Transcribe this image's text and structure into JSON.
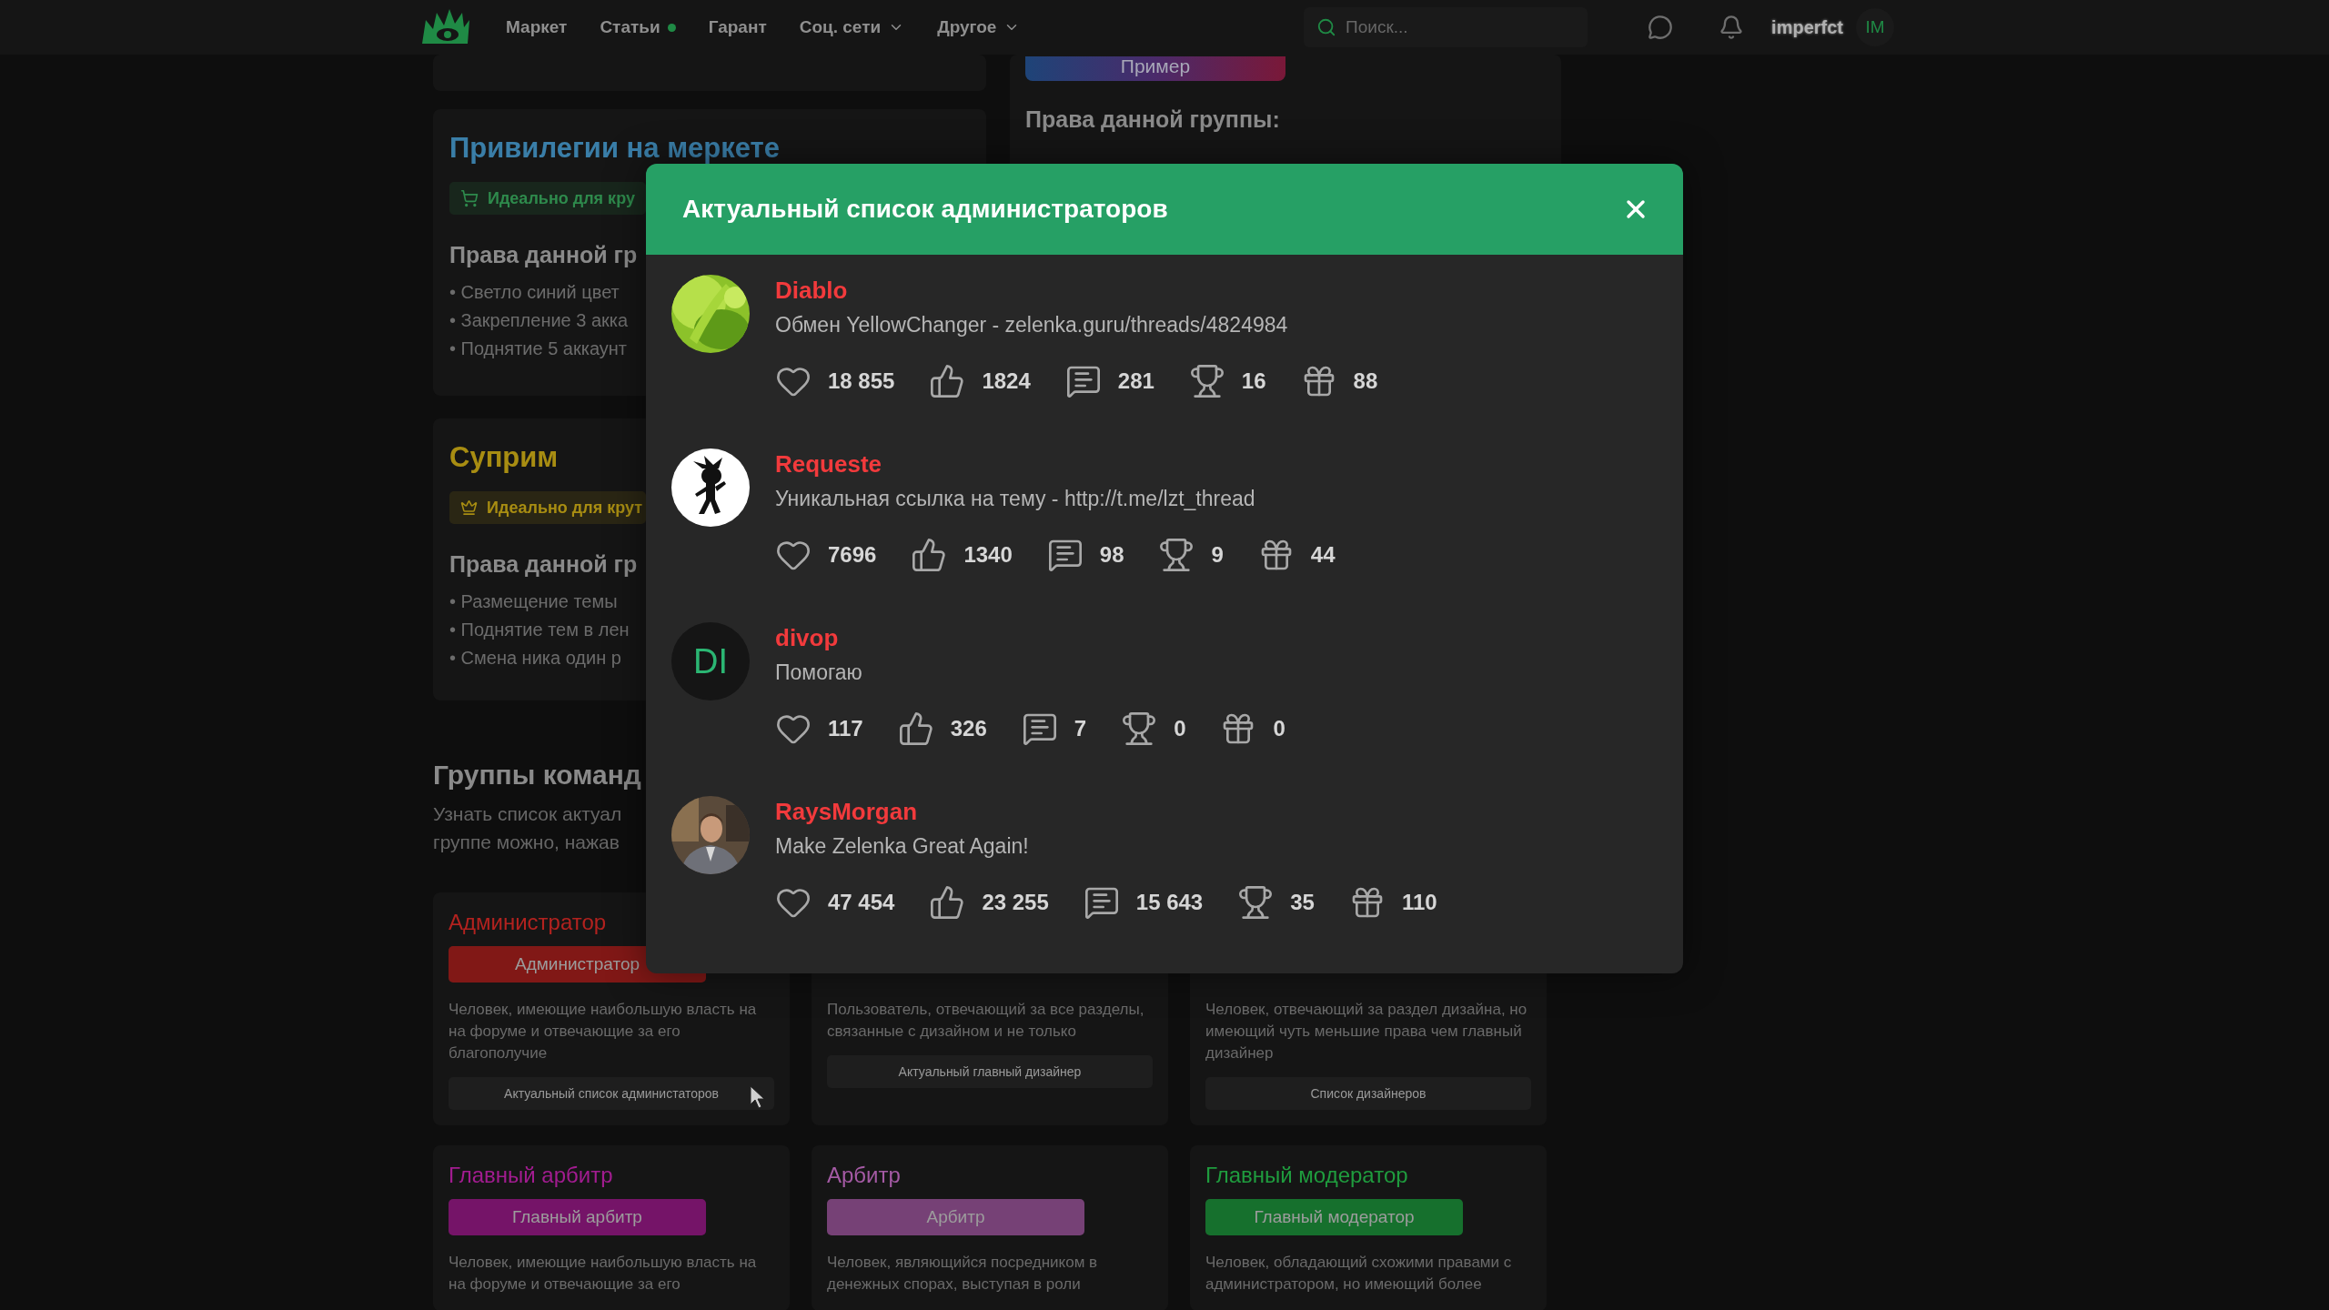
{
  "nav": {
    "items": [
      {
        "label": "Маркет",
        "dot": false,
        "menu": false
      },
      {
        "label": "Статьи",
        "dot": true,
        "menu": false
      },
      {
        "label": "Гарант",
        "dot": false,
        "menu": false
      },
      {
        "label": "Соц. сети",
        "dot": false,
        "menu": true
      },
      {
        "label": "Другое",
        "dot": false,
        "menu": true
      }
    ],
    "search": {
      "placeholder": "Поиск..."
    },
    "user": {
      "name": "imperfct",
      "initials": "IM"
    }
  },
  "privilege_cards": [
    {
      "title": "Привилегии на меркете",
      "color": "#3a7ea8",
      "tag": {
        "text": "Идеально для кру",
        "color": "#2e8a4c"
      },
      "rights_heading": "Права данной гр",
      "rights": [
        "• Светло синий цвет",
        "• Закрепление 3 акка",
        "• Поднятие 5 аккаунт"
      ]
    },
    {
      "title": "Суприм",
      "color": "#a88d12",
      "tag": {
        "text": "Идеально для крут",
        "color": "#a88d12"
      },
      "rights_heading": "Права данной гр",
      "rights": [
        "• Размещение темы",
        "• Поднятие тем в лен",
        "• Смена ника один р"
      ]
    }
  ],
  "example_card": {
    "badge": "Пример",
    "rights_heading": "Права данной группы:"
  },
  "team": {
    "heading": "Группы команд",
    "text_lines": [
      "Узнать список актуал",
      "группе можно, нажав"
    ]
  },
  "groups": [
    {
      "title": "Администратор",
      "color": "#b3221f",
      "badge": "Администратор",
      "description": "Человек, имеющие наибольшую власть на на форуме и отвечающие за его благополучие",
      "button": "Актуальный список администаторов"
    },
    {
      "description": "Пользователь, отвечающий за все разделы, связанные с дизайном и не только",
      "button": "Актуальный главный дизайнер"
    },
    {
      "description": "Человек, отвечающий за раздел дизайна, но имеющий чуть меньшие права чем главный дизайнер",
      "button": "Список дизайнеров"
    },
    {
      "title": "Главный арбитр",
      "color": "#a21c90",
      "badge": "Главный арбитр",
      "description": "Человек, имеющие наибольшую власть на на форуме и отвечающие за его"
    },
    {
      "title": "Арбитр",
      "color": "#a45aa4",
      "badge": "Арбитр",
      "description": "Человек, являющийся посредником в денежных спорах, выступая в роли"
    },
    {
      "title": "Главный модератор",
      "color": "#1f9c3e",
      "badge": "Главный модератор",
      "description": "Человек, обладающий схожими правами с администратором, но имеющий более"
    }
  ],
  "modal": {
    "title": "Актуальный список администраторов",
    "admins": [
      {
        "name": "Diablo",
        "status": "Обмен YellowChanger - zelenka.guru/threads/4824984",
        "avatar": {
          "kind": "leaf"
        },
        "stats": [
          {
            "kind": "likes",
            "value": "18 855"
          },
          {
            "kind": "thumbs",
            "value": "1824"
          },
          {
            "kind": "messages",
            "value": "281"
          },
          {
            "kind": "trophies",
            "value": "16"
          },
          {
            "kind": "gifts",
            "value": "88"
          }
        ]
      },
      {
        "name": "Requeste",
        "status": "Уникальная ссылка на тему - http://t.me/lzt_thread",
        "avatar": {
          "kind": "figure"
        },
        "stats": [
          {
            "kind": "likes",
            "value": "7696"
          },
          {
            "kind": "thumbs",
            "value": "1340"
          },
          {
            "kind": "messages",
            "value": "98"
          },
          {
            "kind": "trophies",
            "value": "9"
          },
          {
            "kind": "gifts",
            "value": "44"
          }
        ]
      },
      {
        "name": "divop",
        "status": "Помогаю",
        "avatar": {
          "kind": "initials",
          "initials": "DI"
        },
        "stats": [
          {
            "kind": "likes",
            "value": "117"
          },
          {
            "kind": "thumbs",
            "value": "326"
          },
          {
            "kind": "messages",
            "value": "7"
          },
          {
            "kind": "trophies",
            "value": "0"
          },
          {
            "kind": "gifts",
            "value": "0"
          }
        ]
      },
      {
        "name": "RaysMorgan",
        "status": "Make Zelenka Great Again!",
        "avatar": {
          "kind": "person"
        },
        "stats": [
          {
            "kind": "likes",
            "value": "47 454"
          },
          {
            "kind": "thumbs",
            "value": "23 255"
          },
          {
            "kind": "messages",
            "value": "15 643"
          },
          {
            "kind": "trophies",
            "value": "35"
          },
          {
            "kind": "gifts",
            "value": "110"
          }
        ]
      }
    ]
  }
}
